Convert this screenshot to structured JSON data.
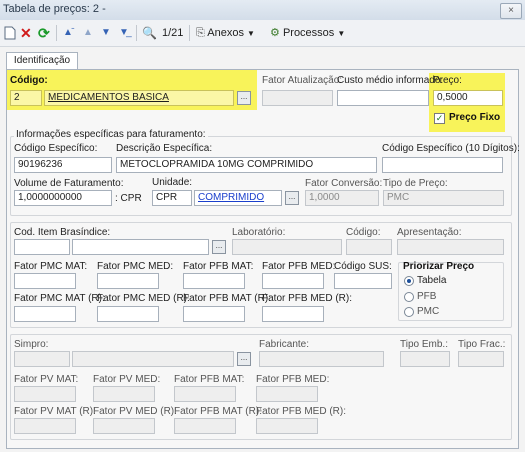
{
  "window": {
    "title": "Tabela de preços: 2 -",
    "close_label": "×"
  },
  "toolbar": {
    "new_icon": "new-document-icon",
    "delete_icon": "delete-icon",
    "refresh_icon": "refresh-icon",
    "first_icon": "first-record-icon",
    "prev_icon": "previous-record-icon",
    "next_icon": "next-record-icon",
    "last_icon": "last-record-icon",
    "search_icon": "binoculars-icon",
    "record_counter": "1/21",
    "anexos_label": "Anexos",
    "processos_label": "Processos"
  },
  "tabs": [
    {
      "label": "Identificação"
    }
  ],
  "codigo": {
    "label": "Código:",
    "value": "2",
    "description": "MEDICAMENTOS BASICA"
  },
  "fator_atualizacao": {
    "label": "Fator Atualização:",
    "value": ""
  },
  "custo_medio": {
    "label": "Custo médio informado:",
    "value": ""
  },
  "preco": {
    "label": "Preço:",
    "value": "0,5000"
  },
  "preco_fixo": {
    "label": "Preço Fixo",
    "checked": true
  },
  "faturamento": {
    "title": "Informações específicas para faturamento:",
    "codigo_especifico": {
      "label": "Código Específico:",
      "value": "90196236"
    },
    "descricao_especifica": {
      "label": "Descrição Específica:",
      "value": "METOCLOPRAMIDA 10MG COMPRIMIDO"
    },
    "codigo_10": {
      "label": "Código Específico (10 Dígitos):",
      "value": ""
    },
    "volume": {
      "label": "Volume de Faturamento:",
      "value": "1,0000000000",
      "unit": ": CPR"
    },
    "unidade": {
      "label": "Unidade:",
      "code": "CPR",
      "description": "COMPRIMIDO"
    },
    "fator_conversao": {
      "label": "Fator Conversão:",
      "value": "1,0000"
    },
    "tipo_preco": {
      "label": "Tipo de Preço:",
      "value": "PMC"
    }
  },
  "brasindice": {
    "cod_item": {
      "label": "Cod. Item Brasíndice:"
    },
    "laboratorio": {
      "label": "Laboratório:"
    },
    "codigo": {
      "label": "Código:"
    },
    "apresentacao": {
      "label": "Apresentação:"
    },
    "row1": [
      "Fator PMC MAT:",
      "Fator PMC MED:",
      "Fator PFB MAT:",
      "Fator PFB MED:",
      "Código SUS:"
    ],
    "row2": [
      "Fator PMC MAT (R):",
      "Fator PMC MED (R):",
      "Fator PFB MAT (R):",
      "Fator PFB MED (R):"
    ],
    "priorizar": {
      "title": "Priorizar Preço",
      "options": [
        "Tabela",
        "PFB",
        "PMC"
      ],
      "selected": "Tabela"
    }
  },
  "simpro": {
    "simpro_label": "Simpro:",
    "fabricante_label": "Fabricante:",
    "tipo_emb_label": "Tipo Emb.:",
    "tipo_frac_label": "Tipo Frac.:",
    "row1": [
      "Fator PV MAT:",
      "Fator PV MED:",
      "Fator PFB MAT:",
      "Fator PFB MED:"
    ],
    "row2": [
      "Fator PV MAT (R):",
      "Fator PV MED (R):",
      "Fator PFB MAT (R):",
      "Fator PFB MED (R):"
    ]
  },
  "ellipsis": "..."
}
